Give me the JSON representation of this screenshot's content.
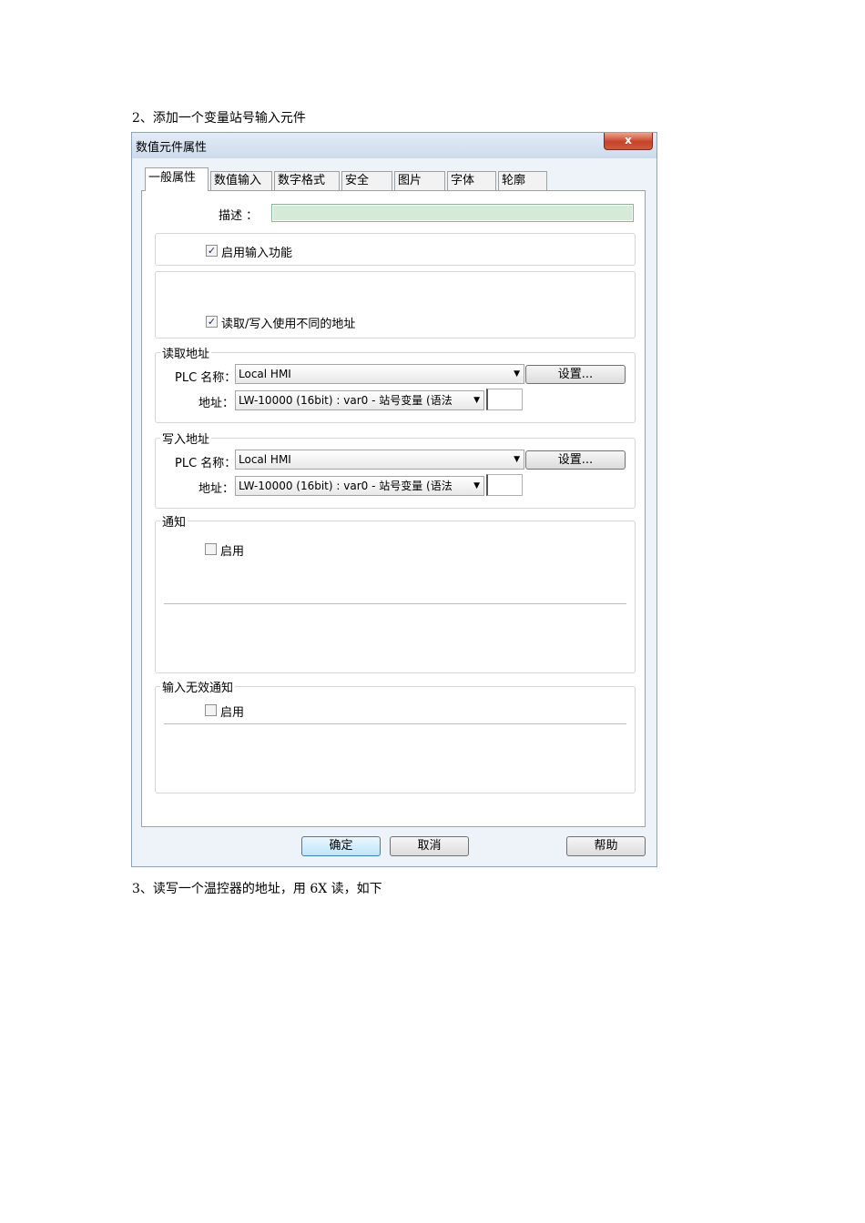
{
  "doc": {
    "step2": "2、添加一个变量站号输入元件",
    "step3": "3、读写一个温控器的地址，用 6X 读，如下"
  },
  "window": {
    "title": "数值元件属性",
    "close_label": "x"
  },
  "tabs": [
    "一般属性",
    "数值输入",
    "数字格式",
    "安全",
    "图片",
    "字体",
    "轮廓"
  ],
  "general": {
    "description_label": "描述 ：",
    "description_value": "",
    "enable_input_label": "启用输入功能",
    "enable_input_checked": true,
    "diff_address_label": "读取/写入使用不同的地址",
    "diff_address_checked": true
  },
  "read_address": {
    "title": "读取地址",
    "plc_label": "PLC 名称：",
    "plc_value": "Local HMI",
    "settings_label": "设置...",
    "address_label": "地址：",
    "address_value": "LW-10000 (16bit) : var0 - 站号变量 (语法"
  },
  "write_address": {
    "title": "写入地址",
    "plc_label": "PLC 名称：",
    "plc_value": "Local HMI",
    "settings_label": "设置...",
    "address_label": "地址：",
    "address_value": "LW-10000 (16bit) : var0 - 站号变量 (语法"
  },
  "notify": {
    "title": "通知",
    "enable_label": "启用",
    "enable_checked": false
  },
  "invalid_notify": {
    "title": "输入无效通知",
    "enable_label": "启用",
    "enable_checked": false
  },
  "footer": {
    "ok_label": "确定",
    "cancel_label": "取消",
    "help_label": "帮助"
  },
  "icons": {
    "check_glyph": "✓",
    "combo_arrow": "▼"
  }
}
